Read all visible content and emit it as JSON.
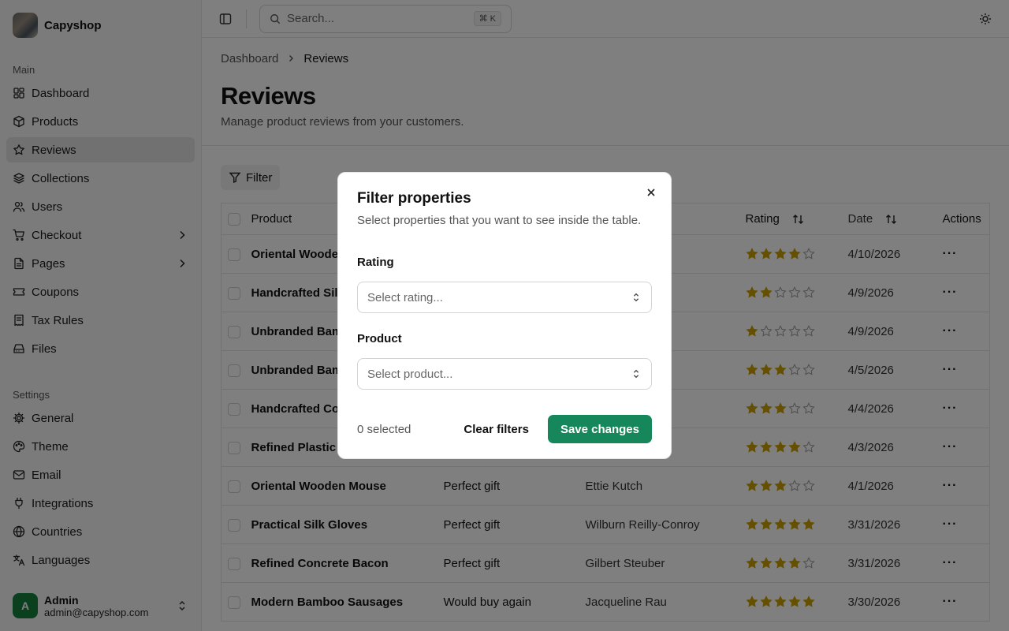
{
  "app": {
    "name": "Capyshop"
  },
  "sidebar": {
    "main_label": "Main",
    "main_items": [
      {
        "label": "Dashboard",
        "icon": "dashboard-icon"
      },
      {
        "label": "Products",
        "icon": "package-icon"
      },
      {
        "label": "Reviews",
        "icon": "star-icon",
        "active": true
      },
      {
        "label": "Collections",
        "icon": "layers-icon"
      },
      {
        "label": "Users",
        "icon": "users-icon"
      },
      {
        "label": "Checkout",
        "icon": "cart-icon",
        "chevron": true
      },
      {
        "label": "Pages",
        "icon": "file-icon",
        "chevron": true
      },
      {
        "label": "Coupons",
        "icon": "ticket-icon"
      },
      {
        "label": "Tax Rules",
        "icon": "receipt-icon"
      },
      {
        "label": "Files",
        "icon": "drive-icon"
      }
    ],
    "settings_label": "Settings",
    "settings_items": [
      {
        "label": "General",
        "icon": "gear-icon"
      },
      {
        "label": "Theme",
        "icon": "palette-icon"
      },
      {
        "label": "Email",
        "icon": "mail-icon"
      },
      {
        "label": "Integrations",
        "icon": "plug-icon"
      },
      {
        "label": "Countries",
        "icon": "globe-icon"
      },
      {
        "label": "Languages",
        "icon": "languages-icon"
      }
    ],
    "user": {
      "initial": "A",
      "name": "Admin",
      "email": "admin@capyshop.com"
    }
  },
  "topbar": {
    "search_placeholder": "Search...",
    "shortcut": "⌘ K"
  },
  "breadcrumb": {
    "root": "Dashboard",
    "current": "Reviews"
  },
  "page": {
    "title": "Reviews",
    "subtitle": "Manage product reviews from your customers."
  },
  "toolbar": {
    "filter_label": "Filter"
  },
  "table": {
    "headers": {
      "product": "Product",
      "rating": "Rating",
      "date": "Date",
      "actions": "Actions"
    },
    "rows": [
      {
        "product": "Oriental Wooden",
        "title": "",
        "author": "",
        "rating": 4,
        "date": "4/10/2026"
      },
      {
        "product": "Handcrafted Silk",
        "title": "",
        "author": "",
        "rating": 2,
        "date": "4/9/2026"
      },
      {
        "product": "Unbranded Bam",
        "title": "",
        "author": "",
        "rating": 1,
        "date": "4/9/2026"
      },
      {
        "product": "Unbranded Bam",
        "title": "",
        "author": "",
        "rating": 3,
        "date": "4/5/2026"
      },
      {
        "product": "Handcrafted Cor",
        "title": "",
        "author": "",
        "rating": 3,
        "date": "4/4/2026"
      },
      {
        "product": "Refined Plastic C",
        "title": "",
        "author": "",
        "rating": 4,
        "date": "4/3/2026"
      },
      {
        "product": "Oriental Wooden Mouse",
        "title": "Perfect gift",
        "author": "Ettie Kutch",
        "rating": 3,
        "date": "4/1/2026"
      },
      {
        "product": "Practical Silk Gloves",
        "title": "Perfect gift",
        "author": "Wilburn Reilly-Conroy",
        "rating": 5,
        "date": "3/31/2026"
      },
      {
        "product": "Refined Concrete Bacon",
        "title": "Perfect gift",
        "author": "Gilbert Steuber",
        "rating": 4,
        "date": "3/31/2026"
      },
      {
        "product": "Modern Bamboo Sausages",
        "title": "Would buy again",
        "author": "Jacqueline Rau",
        "rating": 5,
        "date": "3/30/2026"
      }
    ],
    "actions_glyph": "···"
  },
  "modal": {
    "title": "Filter properties",
    "description": "Select properties that you want to see inside the table.",
    "rating_label": "Rating",
    "rating_placeholder": "Select rating...",
    "product_label": "Product",
    "product_placeholder": "Select product...",
    "selected_count": "0 selected",
    "clear_label": "Clear filters",
    "save_label": "Save changes"
  },
  "colors": {
    "accent": "#16875a",
    "star": "#c9a000",
    "avatar": "#15803d"
  }
}
